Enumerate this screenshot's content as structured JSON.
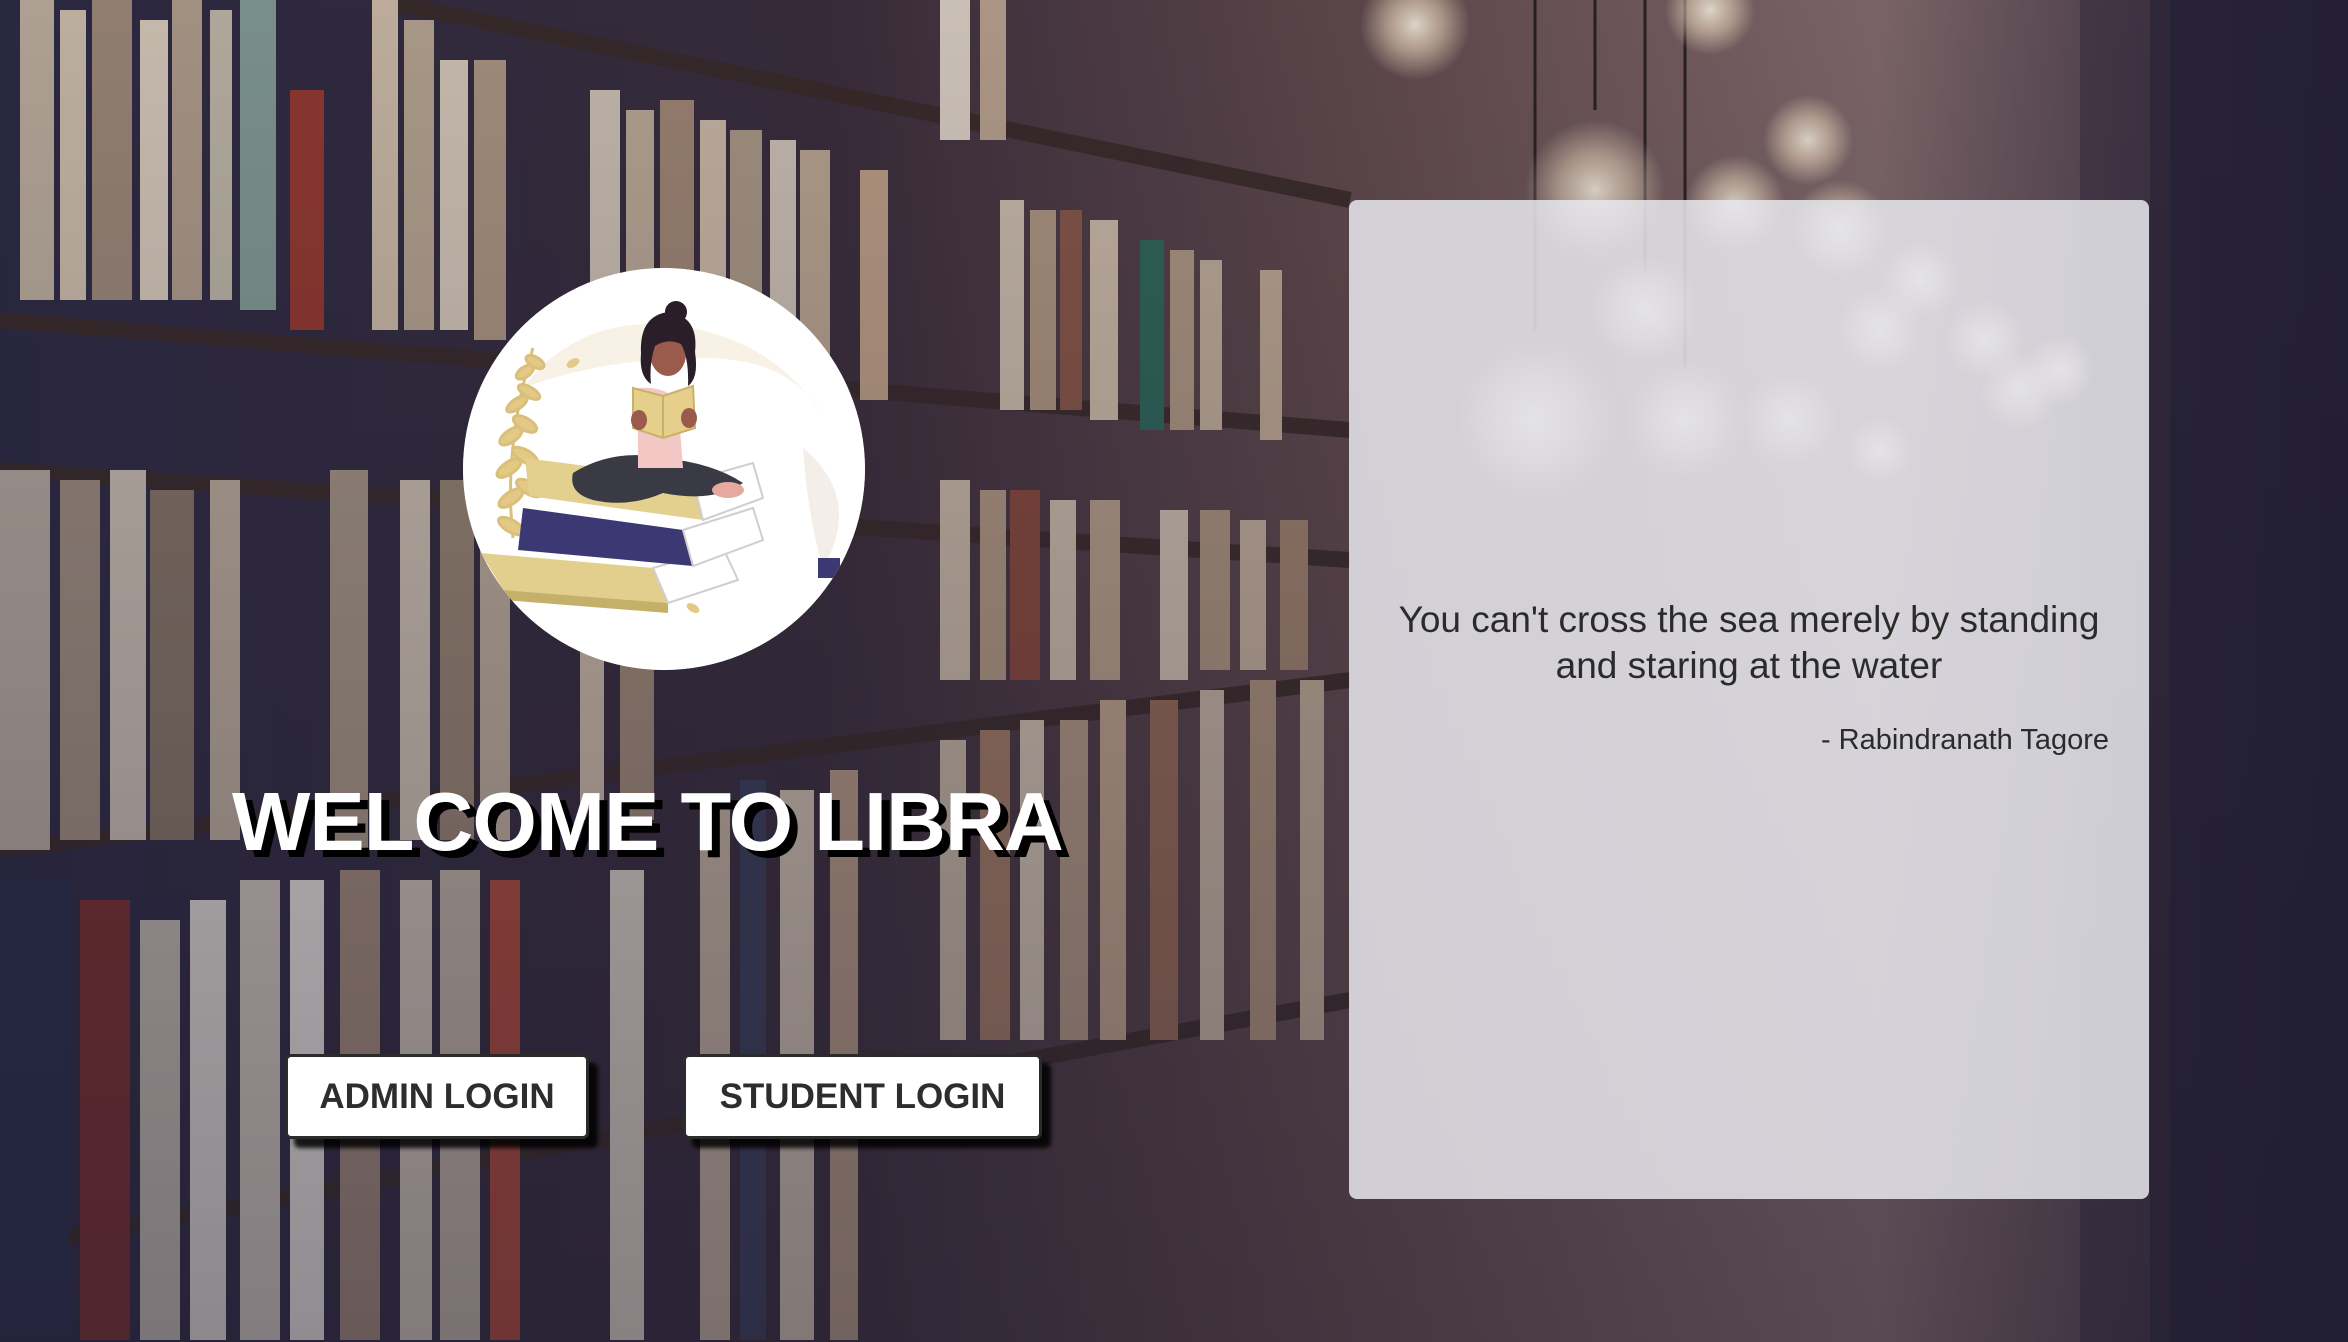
{
  "welcome": {
    "title": "WELCOME TO LIBRA"
  },
  "buttons": {
    "admin_label": "ADMIN LOGIN",
    "student_label": "STUDENT LOGIN"
  },
  "quote": {
    "text": "You can't cross the sea merely by standing and staring at the water",
    "author": "- Rabindranath Tagore"
  },
  "logo": {
    "icon": "reading-woman-on-books-icon"
  },
  "colors": {
    "button_background": "#ffffff",
    "button_text": "#2d2d2d",
    "title": "#ffffff",
    "title_shadow": "#000000",
    "panel_background": "#e8e8ee",
    "quote_text": "#2b2b2b"
  }
}
